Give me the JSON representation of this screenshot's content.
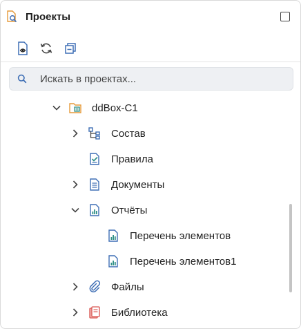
{
  "header": {
    "title": "Проекты",
    "app_icon": "projects-search-icon",
    "maximize_icon": "maximize-icon"
  },
  "toolbar": {
    "buttons": [
      "show-document-icon",
      "refresh-icon",
      "collapse-all-icon"
    ]
  },
  "search": {
    "placeholder": "Искать в проектах...",
    "value": "",
    "icon": "search-icon"
  },
  "tree": {
    "root": {
      "label": "ddBox-C1",
      "icon": "project-icon",
      "expanded": true
    },
    "items": [
      {
        "label": "Состав",
        "icon": "structure-icon",
        "expandable": true,
        "expanded": false
      },
      {
        "label": "Правила",
        "icon": "rules-icon",
        "expandable": false
      },
      {
        "label": "Документы",
        "icon": "documents-icon",
        "expandable": true,
        "expanded": false
      },
      {
        "label": "Отчёты",
        "icon": "report-icon",
        "expandable": true,
        "expanded": true,
        "children": [
          {
            "label": "Перечень элементов",
            "icon": "report-icon"
          },
          {
            "label": "Перечень элементов1",
            "icon": "report-icon"
          }
        ]
      },
      {
        "label": "Файлы",
        "icon": "attachment-icon",
        "expandable": true,
        "expanded": false
      },
      {
        "label": "Библиотека",
        "icon": "library-icon",
        "expandable": true,
        "expanded": false
      }
    ]
  },
  "colors": {
    "accent": "#3f6fb5",
    "teal": "#2f8f86",
    "library_red": "#d9534f",
    "folder_orange": "#e59a3a"
  }
}
